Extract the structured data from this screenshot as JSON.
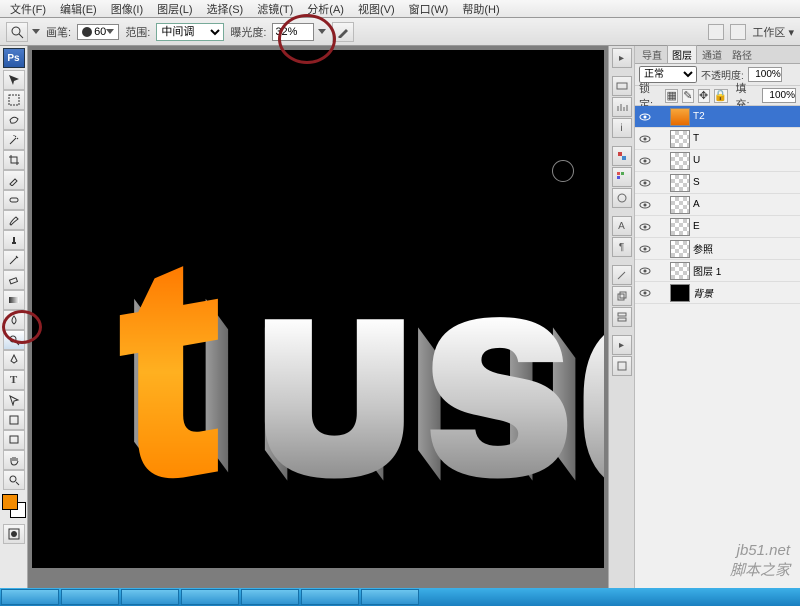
{
  "menu": [
    "文件(F)",
    "编辑(E)",
    "图像(I)",
    "图层(L)",
    "选择(S)",
    "滤镜(T)",
    "分析(A)",
    "视图(V)",
    "窗口(W)",
    "帮助(H)"
  ],
  "options": {
    "brush_label": "画笔:",
    "brush_size": "60",
    "range_label": "范围:",
    "range_value": "中间调",
    "exposure_label": "曝光度:",
    "exposure_value": "32%",
    "workspace_label": "工作区 ▾"
  },
  "panel": {
    "tabs": [
      "导直",
      "图层",
      "通道",
      "路径"
    ],
    "active_tab": 1,
    "blend_mode": "正常",
    "opacity_label": "不透明度:",
    "opacity": "100%",
    "lock_label": "锁定:",
    "fill_label": "填充:",
    "fill": "100%"
  },
  "layers": [
    {
      "name": "T2",
      "thumb": "orange",
      "sel": true
    },
    {
      "name": "T",
      "thumb": "checker"
    },
    {
      "name": "U",
      "thumb": "checker"
    },
    {
      "name": "S",
      "thumb": "checker"
    },
    {
      "name": "A",
      "thumb": "checker"
    },
    {
      "name": "E",
      "thumb": "checker"
    },
    {
      "name": "参照",
      "thumb": "checker"
    },
    {
      "name": "图层 1",
      "thumb": "checker"
    },
    {
      "name": "背景",
      "thumb": "solid",
      "italic": true
    }
  ],
  "watermark": "jb51.net\n脚本之家",
  "swatch": {
    "fg": "#f38b00",
    "bg": "#ffffff"
  }
}
